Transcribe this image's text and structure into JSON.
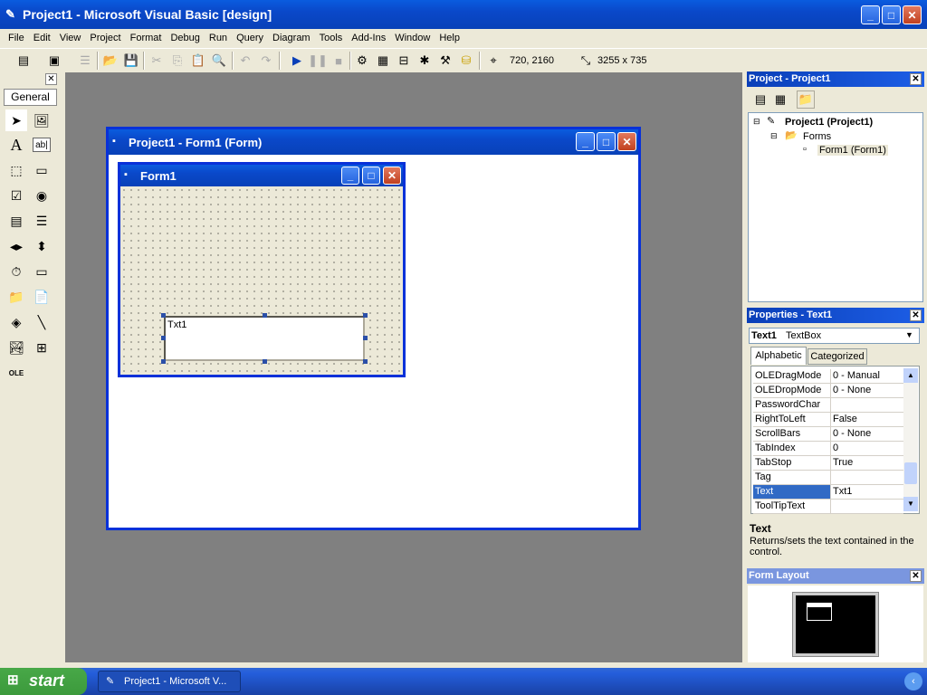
{
  "title_bar": {
    "title": "Project1 - Microsoft Visual Basic [design]"
  },
  "menu": [
    "File",
    "Edit",
    "View",
    "Project",
    "Format",
    "Debug",
    "Run",
    "Query",
    "Diagram",
    "Tools",
    "Add-Ins",
    "Window",
    "Help"
  ],
  "toolbar": {
    "position": "720, 2160",
    "size": "3255 x 735"
  },
  "toolbox": {
    "tab": "General"
  },
  "project_window": {
    "title": "Project1 - Form1 (Form)"
  },
  "form": {
    "title": "Form1",
    "textbox_text": "Txt1"
  },
  "project_explorer": {
    "title": "Project - Project1",
    "root": "Project1 (Project1)",
    "folder": "Forms",
    "item": "Form1 (Form1)"
  },
  "properties": {
    "title": "Properties - Text1",
    "object_name": "Text1",
    "object_type": "TextBox",
    "tab_alpha": "Alphabetic",
    "tab_cat": "Categorized",
    "rows": [
      {
        "name": "OLEDragMode",
        "value": "0 - Manual"
      },
      {
        "name": "OLEDropMode",
        "value": "0 - None"
      },
      {
        "name": "PasswordChar",
        "value": ""
      },
      {
        "name": "RightToLeft",
        "value": "False"
      },
      {
        "name": "ScrollBars",
        "value": "0 - None"
      },
      {
        "name": "TabIndex",
        "value": "0"
      },
      {
        "name": "TabStop",
        "value": "True"
      },
      {
        "name": "Tag",
        "value": ""
      },
      {
        "name": "Text",
        "value": "Txt1"
      },
      {
        "name": "ToolTipText",
        "value": ""
      }
    ],
    "selected_row": "Text",
    "desc_title": "Text",
    "desc_text": "Returns/sets the text contained in the control."
  },
  "form_layout": {
    "title": "Form Layout"
  },
  "taskbar": {
    "start": "start",
    "task": "Project1 - Microsoft V..."
  },
  "colors": {
    "xp_blue": "#0a48c9",
    "workspace": "#808080",
    "start_green": "#3c9a3c"
  }
}
